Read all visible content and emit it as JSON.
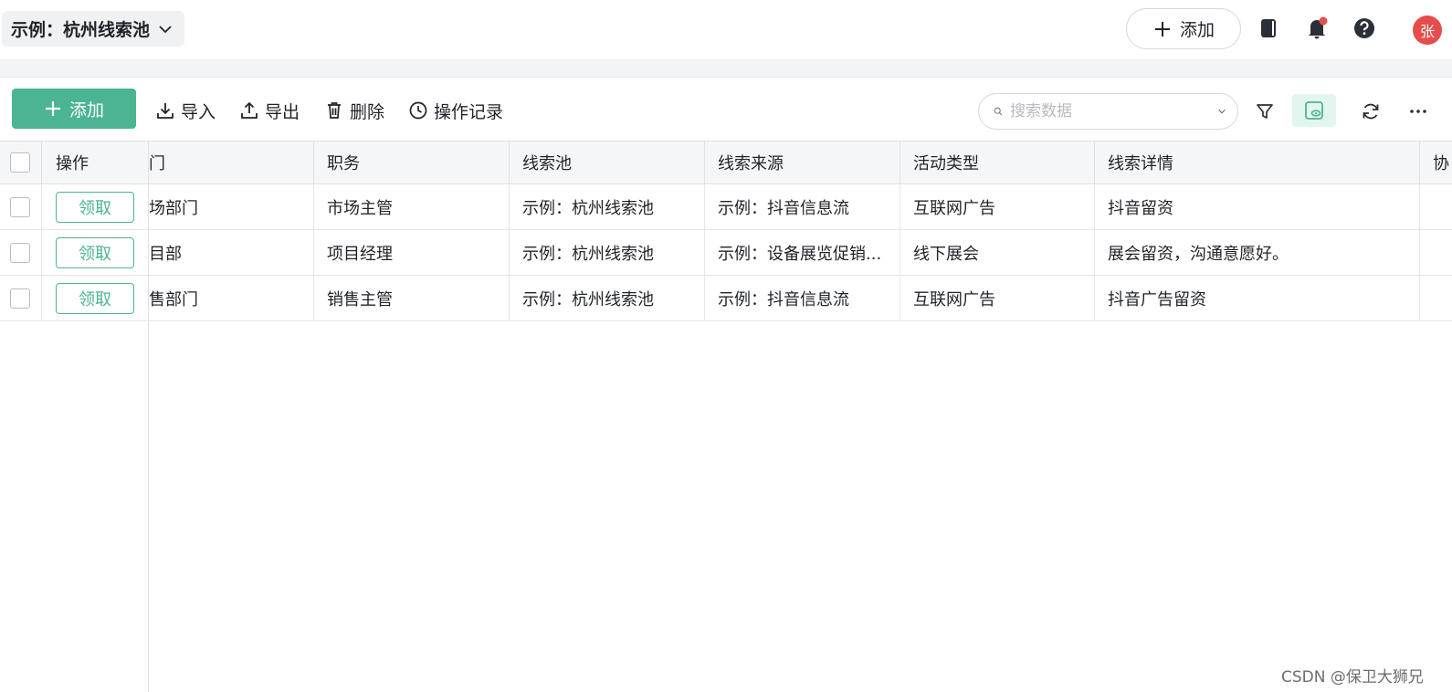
{
  "header": {
    "pool_selector": "示例：杭州线索池",
    "add_label": "添加",
    "avatar_text": "张",
    "icons": [
      "book-icon",
      "bell-icon",
      "help-icon"
    ],
    "notification_dot_color": "#e74c4c"
  },
  "toolbar": {
    "add_label": "添加",
    "import_label": "导入",
    "export_label": "导出",
    "delete_label": "删除",
    "history_label": "操作记录",
    "search_placeholder": "搜索数据",
    "accent_color": "#4bb493"
  },
  "table": {
    "columns": {
      "action": "操作",
      "dept": "门",
      "position": "职务",
      "pool": "线索池",
      "source": "线索来源",
      "activity": "活动类型",
      "details": "线索详情",
      "partial": "协"
    },
    "claim_label": "领取",
    "rows": [
      {
        "dept": "场部门",
        "position": "市场主管",
        "pool": "示例：杭州线索池",
        "source": "示例：抖音信息流",
        "activity": "互联网广告",
        "details": "抖音留资"
      },
      {
        "dept": "目部",
        "position": "项目经理",
        "pool": "示例：杭州线索池",
        "source": "示例：设备展览促销...",
        "activity": "线下展会",
        "details": "展会留资，沟通意愿好。"
      },
      {
        "dept": "售部门",
        "position": "销售主管",
        "pool": "示例：杭州线索池",
        "source": "示例：抖音信息流",
        "activity": "互联网广告",
        "details": "抖音广告留资"
      }
    ]
  },
  "watermark": "CSDN @保卫大狮兄"
}
